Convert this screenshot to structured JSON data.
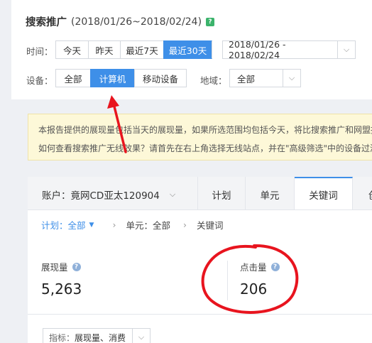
{
  "header": {
    "title": "搜索推广",
    "date_range": "(2018/01/26~2018/02/24)",
    "help_glyph": "?"
  },
  "time_filter": {
    "label": "时间：",
    "options": [
      "今天",
      "昨天",
      "最近7天",
      "最近30天"
    ],
    "active_index": 3,
    "range_value": "2018/01/26 - 2018/02/24"
  },
  "device_filter": {
    "label": "设备：",
    "options": [
      "全部",
      "计算机",
      "移动设备"
    ],
    "active_index": 1
  },
  "region_filter": {
    "label": "地域：",
    "value": "全部"
  },
  "notice": {
    "line1": "本报告提供的展现量包括当天的展现量，如果所选范围均包括今天，将比搜索推广和网盟报",
    "line2": "如何查看搜索推广无线效果？请首先在右上角选择无线站点，并在\"高级筛选\"中的设备过滤"
  },
  "tabs": {
    "account": "账户：竟网CD亚太120904",
    "items": [
      "计划",
      "单元",
      "关键词",
      "创"
    ],
    "active_index": 2
  },
  "breadcrumb": {
    "plan": "计划：全部",
    "unit": "单元：全部",
    "keyword": "关键词"
  },
  "metrics": [
    {
      "label": "展现量",
      "value": "5,263"
    },
    {
      "label": "点击量",
      "value": "206"
    }
  ],
  "indicator": {
    "label": "指标：",
    "value": "展现量、消费"
  },
  "annotation_colors": {
    "red": "#e8141e",
    "accent": "#3e8fe8"
  }
}
